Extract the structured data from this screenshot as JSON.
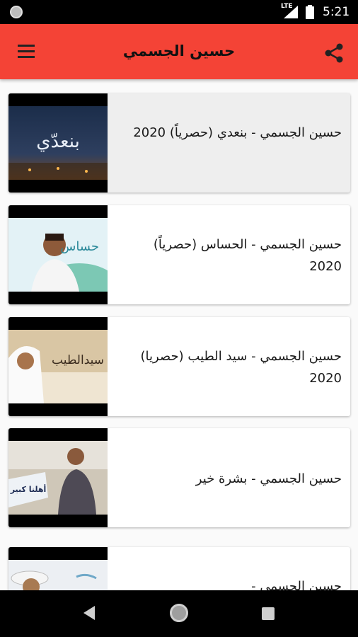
{
  "status_bar": {
    "time": "5:21",
    "network": "LTE"
  },
  "app_bar": {
    "title": "حسين الجسمي"
  },
  "videos": [
    {
      "title": "حسين الجسمي - بنعدي (حصرياً) 2020",
      "thumb_text": "بنعدّي"
    },
    {
      "title": "حسين الجسمي - الحساس (حصرياً) 2020",
      "thumb_text": "حساس"
    },
    {
      "title": "حسين الجسمي - سيد الطيب (حصريا) 2020",
      "thumb_text": "سيدالطيب"
    },
    {
      "title": "حسين الجسمي - بشرة خير",
      "thumb_text": "أهلنا كبير"
    },
    {
      "title": "حسين الجسمي -",
      "thumb_text": ""
    }
  ],
  "colors": {
    "app_bar": "#f44336",
    "status_bar": "#000000",
    "nav_bar": "#000000"
  }
}
